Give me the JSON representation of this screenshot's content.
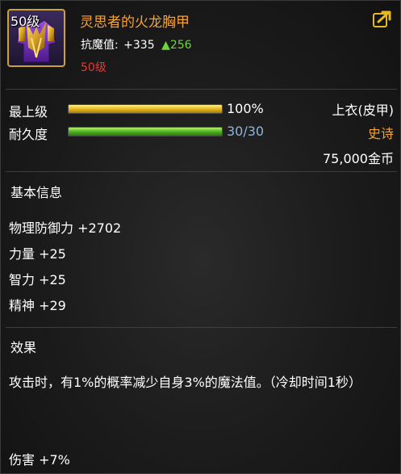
{
  "item": {
    "level_badge": "50级",
    "name": "灵思者的火龙胸甲",
    "magic_resist_label": "抗魔值:",
    "magic_resist_value": "+335",
    "magic_resist_up": "▲256",
    "required_level": "50级",
    "icon": "chest-armor-icon"
  },
  "colors": {
    "name": "#f4a23a",
    "required_level": "#e53a3a",
    "increase": "#6fd63a",
    "durability_text": "#8fb4d8",
    "rarity": "#f4a23a",
    "frame": "#c9a23a"
  },
  "stats": {
    "max_level_label": "最上级",
    "max_level_value": "100%",
    "max_level_fraction": 1.0,
    "durability_label": "耐久度",
    "durability_value": "30/30",
    "durability_fraction": 1.0,
    "item_type": "上衣(皮甲)",
    "rarity": "史诗",
    "price": "75,000金币"
  },
  "basic_info": {
    "title": "基本信息",
    "attributes": [
      "物理防御力 +2702",
      "力量 +25",
      "智力 +25",
      "精神 +29"
    ]
  },
  "effect": {
    "title": "效果",
    "description": "攻击时，有1%的概率减少自身3%的魔法值。（冷却时间1秒）",
    "damage": "伤害 +7%"
  },
  "share_icon": "share-icon"
}
